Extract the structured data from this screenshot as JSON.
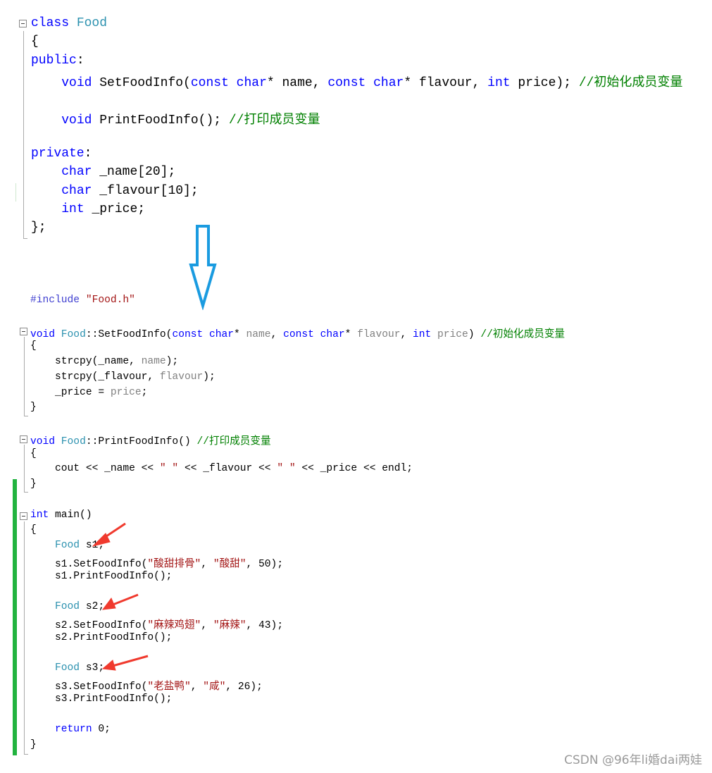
{
  "header_code": [
    [
      [
        "class ",
        "kw"
      ],
      [
        "Food",
        "ty"
      ]
    ],
    [
      [
        "{",
        "tx"
      ]
    ],
    [
      [
        "public",
        "kw"
      ],
      [
        ":",
        "tx"
      ]
    ],
    [
      [
        "    ",
        "tx"
      ],
      [
        "void ",
        "kw"
      ],
      [
        "SetFoodInfo(",
        "tx"
      ],
      [
        "const ",
        "kw"
      ],
      [
        "char",
        "kw"
      ],
      [
        "* name, ",
        "tx"
      ],
      [
        "const ",
        "kw"
      ],
      [
        "char",
        "kw"
      ],
      [
        "* flavour, ",
        "tx"
      ],
      [
        "int ",
        "kw"
      ],
      [
        "price); ",
        "tx"
      ],
      [
        "//初始化成员变量",
        "cm"
      ]
    ],
    [],
    [
      [
        "    ",
        "tx"
      ],
      [
        "void ",
        "kw"
      ],
      [
        "PrintFoodInfo(); ",
        "tx"
      ],
      [
        "//打印成员变量",
        "cm"
      ]
    ],
    [],
    [
      [
        "private",
        "kw"
      ],
      [
        ":",
        "tx"
      ]
    ],
    [
      [
        "    ",
        "tx"
      ],
      [
        "char ",
        "kw"
      ],
      [
        "_name[20];",
        "tx"
      ]
    ],
    [
      [
        "    ",
        "tx"
      ],
      [
        "char ",
        "kw"
      ],
      [
        "_flavour[10];",
        "tx"
      ]
    ],
    [
      [
        "    ",
        "tx"
      ],
      [
        "int ",
        "kw"
      ],
      [
        "_price;",
        "tx"
      ]
    ],
    [
      [
        "};",
        "tx"
      ]
    ]
  ],
  "source_code": [
    [
      [
        "#include ",
        "pp"
      ],
      [
        "\"Food.h\"",
        "st"
      ]
    ],
    [],
    [
      [
        "void ",
        "kw"
      ],
      [
        "Food",
        "ty"
      ],
      [
        "::SetFoodInfo(",
        "tx"
      ],
      [
        "const ",
        "kw"
      ],
      [
        "char",
        "kw"
      ],
      [
        "* ",
        "tx"
      ],
      [
        "name",
        "pm"
      ],
      [
        ", ",
        "tx"
      ],
      [
        "const ",
        "kw"
      ],
      [
        "char",
        "kw"
      ],
      [
        "* ",
        "tx"
      ],
      [
        "flavour",
        "pm"
      ],
      [
        ", ",
        "tx"
      ],
      [
        "int ",
        "kw"
      ],
      [
        "price",
        "pm"
      ],
      [
        ") ",
        "tx"
      ],
      [
        "//初始化成员变量",
        "cm"
      ]
    ],
    [
      [
        "{",
        "tx"
      ]
    ],
    [
      [
        "    strcpy(_name, ",
        "tx"
      ],
      [
        "name",
        "pm"
      ],
      [
        ");",
        "tx"
      ]
    ],
    [
      [
        "    strcpy(_flavour, ",
        "tx"
      ],
      [
        "flavour",
        "pm"
      ],
      [
        ");",
        "tx"
      ]
    ],
    [
      [
        "    _price = ",
        "tx"
      ],
      [
        "price",
        "pm"
      ],
      [
        ";",
        "tx"
      ]
    ],
    [
      [
        "}",
        "tx"
      ]
    ],
    [],
    [
      [
        "void ",
        "kw"
      ],
      [
        "Food",
        "ty"
      ],
      [
        "::PrintFoodInfo() ",
        "tx"
      ],
      [
        "//打印成员变量",
        "cm"
      ]
    ],
    [
      [
        "{",
        "tx"
      ]
    ],
    [
      [
        "    cout << _name << ",
        "tx"
      ],
      [
        "\" \"",
        "st"
      ],
      [
        " << _flavour << ",
        "tx"
      ],
      [
        "\" \"",
        "st"
      ],
      [
        " << _price << endl;",
        "tx"
      ]
    ],
    [
      [
        "}",
        "tx"
      ]
    ],
    [],
    [
      [
        "int ",
        "kw"
      ],
      [
        "main()",
        "tx"
      ]
    ],
    [
      [
        "{",
        "tx"
      ]
    ],
    [
      [
        "    ",
        "tx"
      ],
      [
        "Food ",
        "ty"
      ],
      [
        "s1;",
        "tx"
      ]
    ],
    [
      [
        "    s1.SetFoodInfo(",
        "tx"
      ],
      [
        "\"酸甜排骨\"",
        "st"
      ],
      [
        ", ",
        "tx"
      ],
      [
        "\"酸甜\"",
        "st"
      ],
      [
        ", 50);",
        "tx"
      ]
    ],
    [
      [
        "    s1.PrintFoodInfo();",
        "tx"
      ]
    ],
    [],
    [
      [
        "    ",
        "tx"
      ],
      [
        "Food ",
        "ty"
      ],
      [
        "s2;",
        "tx"
      ]
    ],
    [
      [
        "    s2.SetFoodInfo(",
        "tx"
      ],
      [
        "\"麻辣鸡翅\"",
        "st"
      ],
      [
        ", ",
        "tx"
      ],
      [
        "\"麻辣\"",
        "st"
      ],
      [
        ", 43);",
        "tx"
      ]
    ],
    [
      [
        "    s2.PrintFoodInfo();",
        "tx"
      ]
    ],
    [],
    [
      [
        "    ",
        "tx"
      ],
      [
        "Food ",
        "ty"
      ],
      [
        "s3;",
        "tx"
      ]
    ],
    [
      [
        "    s3.SetFoodInfo(",
        "tx"
      ],
      [
        "\"老盐鸭\"",
        "st"
      ],
      [
        ", ",
        "tx"
      ],
      [
        "\"咸\"",
        "st"
      ],
      [
        ", 26);",
        "tx"
      ]
    ],
    [
      [
        "    s3.PrintFoodInfo();",
        "tx"
      ]
    ],
    [],
    [
      [
        "    return ",
        "kw"
      ],
      [
        "0;",
        "tx"
      ]
    ],
    [
      [
        "}",
        "tx"
      ]
    ]
  ],
  "watermark": "CSDN @96年li婚dai两娃",
  "colors": {
    "arrow": "#1a9be0",
    "pointer": "#f03a2e",
    "change_bar": "#22b33f"
  }
}
